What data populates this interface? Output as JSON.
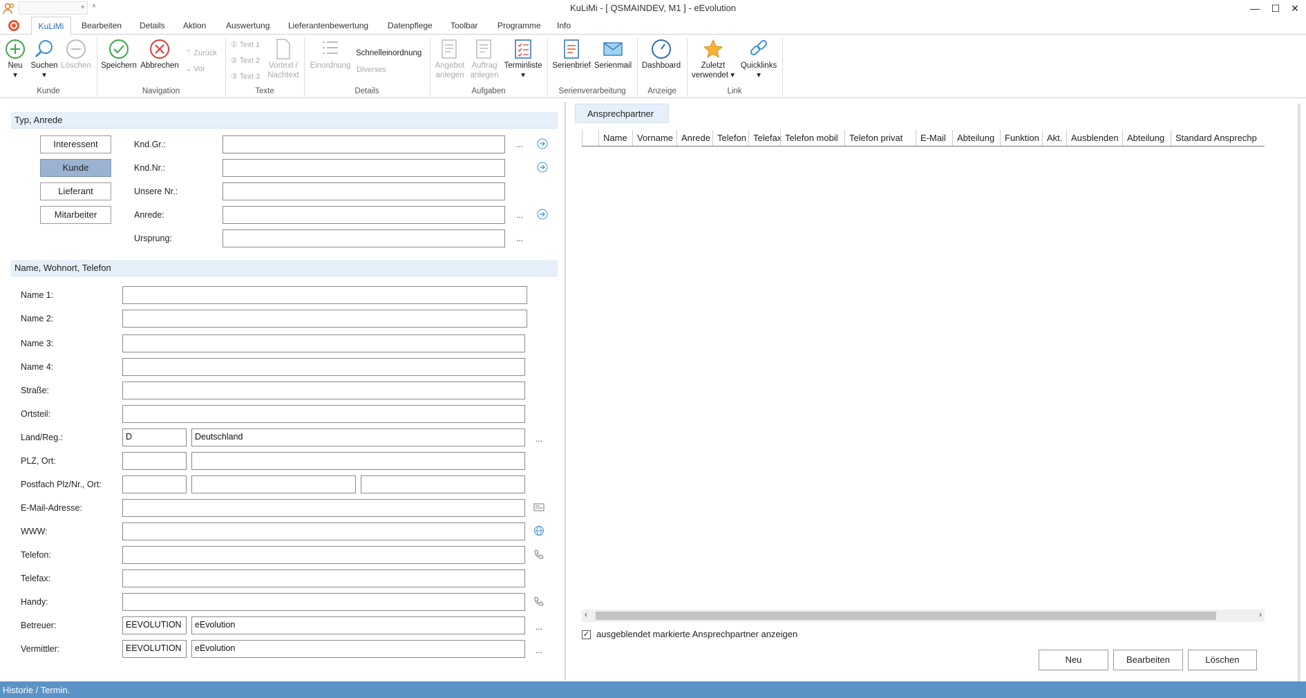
{
  "window": {
    "title": "KuLiMi - [ QSMAINDEV, M1 ]  -  eEvolution",
    "minimize": "—",
    "maximize": "☐",
    "close": "✕"
  },
  "ribbon_tabs": [
    "KuLiMi",
    "Bearbeiten",
    "Details",
    "Aktion",
    "Auswertung",
    "Lieferantenbewertung",
    "Datenpflege",
    "Toolbar",
    "Programme",
    "Info"
  ],
  "ribbon": {
    "kunde": {
      "group": "Kunde",
      "neu": "Neu",
      "suchen": "Suchen",
      "loeschen": "Löschen"
    },
    "navigation": {
      "group": "Navigation",
      "speichern": "Speichern",
      "abbrechen": "Abbrechen",
      "zurueck": "Zurück",
      "vor": "Vor"
    },
    "texte": {
      "group": "Texte",
      "text1": "Text 1",
      "text2": "Text 2",
      "text3": "Text 3",
      "vortext": "Vortext /",
      "nachtext": "Nachtext"
    },
    "details": {
      "group": "Details",
      "einordnung": "Einordnung",
      "schnelleinordnung": "Schnelleinordnung",
      "diverses": "Diverses"
    },
    "aufgaben": {
      "group": "Aufgaben",
      "angebot1": "Angebot",
      "angebot2": "anlegen",
      "auftrag1": "Auftrag",
      "auftrag2": "anlegen",
      "terminliste": "Terminliste"
    },
    "serien": {
      "group": "Serienverarbeitung",
      "serienbrief": "Serienbrief",
      "serienmail": "Serienmail"
    },
    "anzeige": {
      "group": "Anzeige",
      "dashboard": "Dashboard"
    },
    "link": {
      "group": "Link",
      "zuletzt1": "Zuletzt",
      "zuletzt2": "verwendet",
      "quicklinks": "Quicklinks"
    }
  },
  "typ": {
    "section": "Typ, Anrede",
    "buttons": [
      "Interessent",
      "Kunde",
      "Lieferant",
      "Mitarbeiter"
    ],
    "selected": "Kunde",
    "labels": {
      "kndgr": "Knd.Gr.:",
      "kndnr": "Knd.Nr.:",
      "unsere": "Unsere Nr.:",
      "anrede": "Anrede:",
      "ursprung": "Ursprung:"
    },
    "values": {
      "kndgr": "",
      "kndnr": "",
      "unsere": "",
      "anrede": "",
      "ursprung": ""
    }
  },
  "name_section": {
    "section": "Name, Wohnort, Telefon",
    "labels": {
      "name1": "Name 1:",
      "name2": "Name 2:",
      "name3": "Name 3:",
      "name4": "Name 4:",
      "strasse": "Straße:",
      "ortsteil": "Ortsteil:",
      "land": "Land/Reg.:",
      "plz": "PLZ, Ort:",
      "postfach": "Postfach Plz/Nr., Ort:",
      "email": "E-Mail-Adresse:",
      "www": "WWW:",
      "telefon": "Telefon:",
      "telefax": "Telefax:",
      "handy": "Handy:",
      "betreuer": "Betreuer:",
      "vermittler": "Vermittler:"
    },
    "values": {
      "land_code": "D",
      "land_name": "Deutschland",
      "betreuer_code": "EEVOLUTION",
      "betreuer_name": "eEvolution",
      "vermittler_code": "EEVOLUTION",
      "vermittler_name": "eEvolution"
    }
  },
  "ansprechpartner": {
    "tab": "Ansprechpartner",
    "columns": [
      "Name",
      "Vorname",
      "Anrede",
      "Telefon",
      "Telefax",
      "Telefon mobil",
      "Telefon privat",
      "E-Mail",
      "Abteilung",
      "Funktion",
      "Akt.",
      "Ausblenden",
      "Abteilung",
      "Standard Ansprechp"
    ],
    "checkbox_label": "ausgeblendet markierte Ansprechpartner anzeigen",
    "checkbox_checked": true,
    "buttons": {
      "neu": "Neu",
      "bearbeiten": "Bearbeiten",
      "loeschen": "Löschen"
    }
  },
  "statusbar": "Historie / Termin.",
  "colors": {
    "accent": "#2a6ebb",
    "status": "#5b93c7",
    "section": "#e6f0fa",
    "selected": "#9bb2d1"
  }
}
